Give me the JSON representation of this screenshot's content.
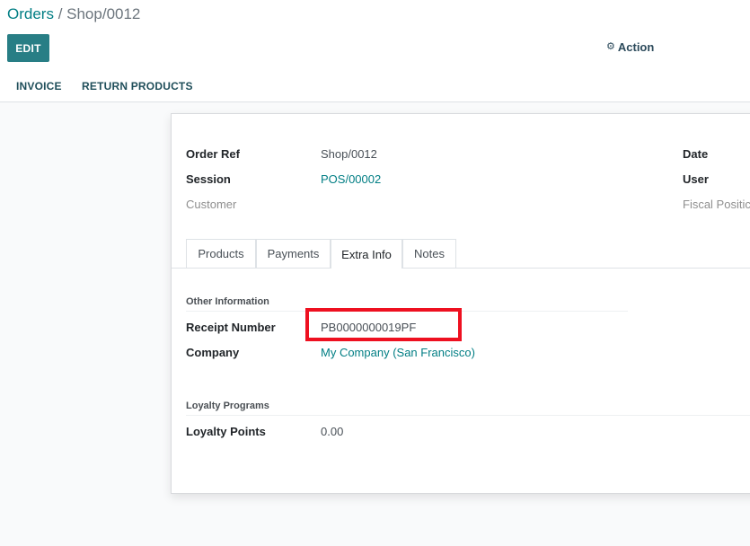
{
  "breadcrumb": {
    "parent": "Orders",
    "separator": " / ",
    "current": "Shop/0012"
  },
  "toolbar": {
    "edit_label": "EDIT",
    "action_label": "Action",
    "action_icon": "gear-icon"
  },
  "statusbar": {
    "invoice_label": "INVOICE",
    "return_label": "RETURN PRODUCTS"
  },
  "header_fields": {
    "order_ref_label": "Order Ref",
    "order_ref_value": "Shop/0012",
    "session_label": "Session",
    "session_value": "POS/00002",
    "customer_label": "Customer",
    "date_label": "Date",
    "user_label": "User",
    "fiscal_label": "Fiscal Positic"
  },
  "tabs": [
    {
      "label": "Products",
      "active": false
    },
    {
      "label": "Payments",
      "active": false
    },
    {
      "label": "Extra Info",
      "active": true
    },
    {
      "label": "Notes",
      "active": false
    }
  ],
  "other_info": {
    "title": "Other Information",
    "receipt_label": "Receipt Number",
    "receipt_value": "PB0000000019PF",
    "company_label": "Company",
    "company_value": "My Company (San Francisco)"
  },
  "loyalty": {
    "title": "Loyalty Programs",
    "points_label": "Loyalty Points",
    "points_value": "0.00"
  },
  "colors": {
    "primary": "#287e85",
    "link": "#017e84",
    "highlight": "#ee1020"
  }
}
